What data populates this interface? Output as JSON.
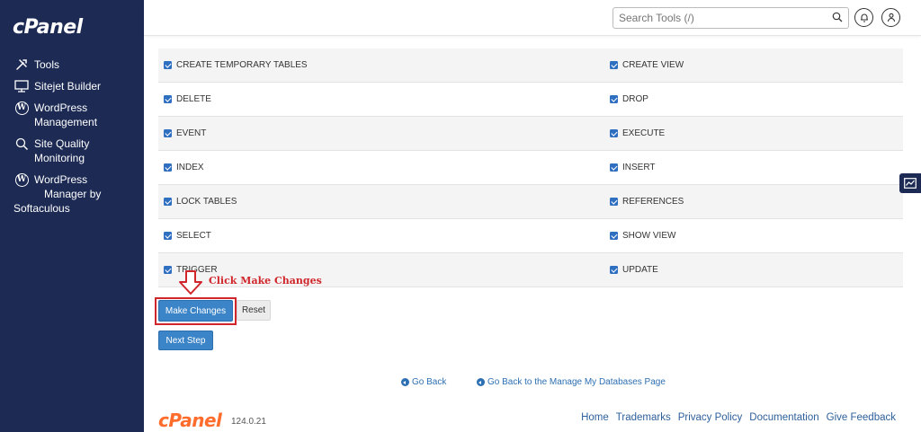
{
  "sidebar": {
    "brand": "cPanel",
    "items": [
      {
        "icon": "tools-icon",
        "label": "Tools"
      },
      {
        "icon": "sitejet-icon",
        "label": "Sitejet Builder"
      },
      {
        "icon": "wordpress-icon",
        "label": "WordPress\nManagement"
      },
      {
        "icon": "site-quality-icon",
        "label": "Site Quality\nMonitoring"
      },
      {
        "icon": "wordpress-icon",
        "label": "WordPress\nManager by"
      },
      {
        "label": "Softaculous"
      }
    ]
  },
  "header": {
    "search_placeholder": "Search Tools (/)",
    "icons": [
      "search-icon",
      "bell-icon",
      "user-icon"
    ]
  },
  "privileges": [
    [
      "CREATE TEMPORARY TABLES",
      "CREATE VIEW"
    ],
    [
      "DELETE",
      "DROP"
    ],
    [
      "EVENT",
      "EXECUTE"
    ],
    [
      "INDEX",
      "INSERT"
    ],
    [
      "LOCK TABLES",
      "REFERENCES"
    ],
    [
      "SELECT",
      "SHOW VIEW"
    ],
    [
      "TRIGGER",
      "UPDATE"
    ]
  ],
  "actions": {
    "make_changes": "Make Changes",
    "reset": "Reset",
    "next_step": "Next Step"
  },
  "annotation": "Click Make Changes",
  "links": {
    "go_back": "Go Back",
    "go_back_manage": "Go Back to the Manage My Databases Page"
  },
  "footer": {
    "brand": "cPanel",
    "version": "124.0.21",
    "links": [
      "Home",
      "Trademarks",
      "Privacy Policy",
      "Documentation",
      "Give Feedback"
    ]
  },
  "colors": {
    "sidebar": "#1c2a54",
    "primary": "#3b84c8",
    "annotation": "#d0262b",
    "brand_orange": "#ff6c2c"
  }
}
